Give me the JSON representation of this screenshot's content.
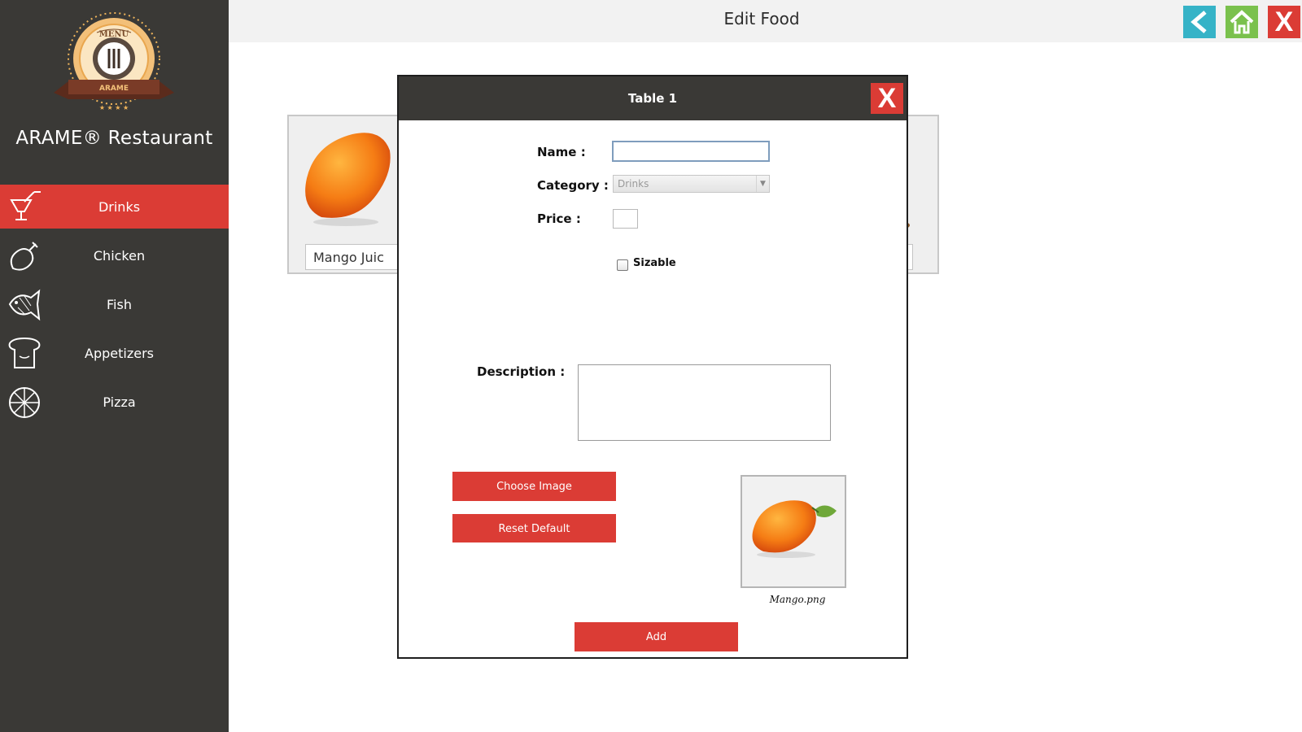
{
  "app": {
    "brand": "ARAME® Restaurant",
    "logo_text_top": "MENU",
    "logo_text_banner": "ARAME"
  },
  "sidebar": {
    "items": [
      {
        "label": "Drinks",
        "icon": "drink-icon",
        "active": true
      },
      {
        "label": "Chicken",
        "icon": "chicken-icon",
        "active": false
      },
      {
        "label": "Fish",
        "icon": "fish-icon",
        "active": false
      },
      {
        "label": "Appetizers",
        "icon": "bread-icon",
        "active": false
      },
      {
        "label": "Pizza",
        "icon": "pizza-icon",
        "active": false
      }
    ]
  },
  "header": {
    "title": "Edit Food",
    "buttons": [
      "back-icon",
      "home-icon",
      "close-icon"
    ],
    "close_label": "X"
  },
  "background_cards": [
    {
      "label": "Mango Juic"
    }
  ],
  "dialog": {
    "title": "Table 1",
    "close_label": "X",
    "fields": {
      "name_label": "Name :",
      "name_value": "",
      "category_label": "Category :",
      "category_value": "Drinks",
      "price_label": "Price :",
      "price_value": "",
      "sizable_label": "Sizable",
      "sizable_checked": false,
      "description_label": "Description :",
      "description_value": ""
    },
    "buttons": {
      "choose_image": "Choose Image",
      "reset_default": "Reset Default",
      "add": "Add"
    },
    "image_preview": {
      "filename": "Mango.png"
    }
  },
  "colors": {
    "sidebar_bg": "#3a3936",
    "accent_red": "#db3c35",
    "back_button": "#36b3c7",
    "home_button": "#7ac14d",
    "header_bg": "#f2f2f2"
  }
}
